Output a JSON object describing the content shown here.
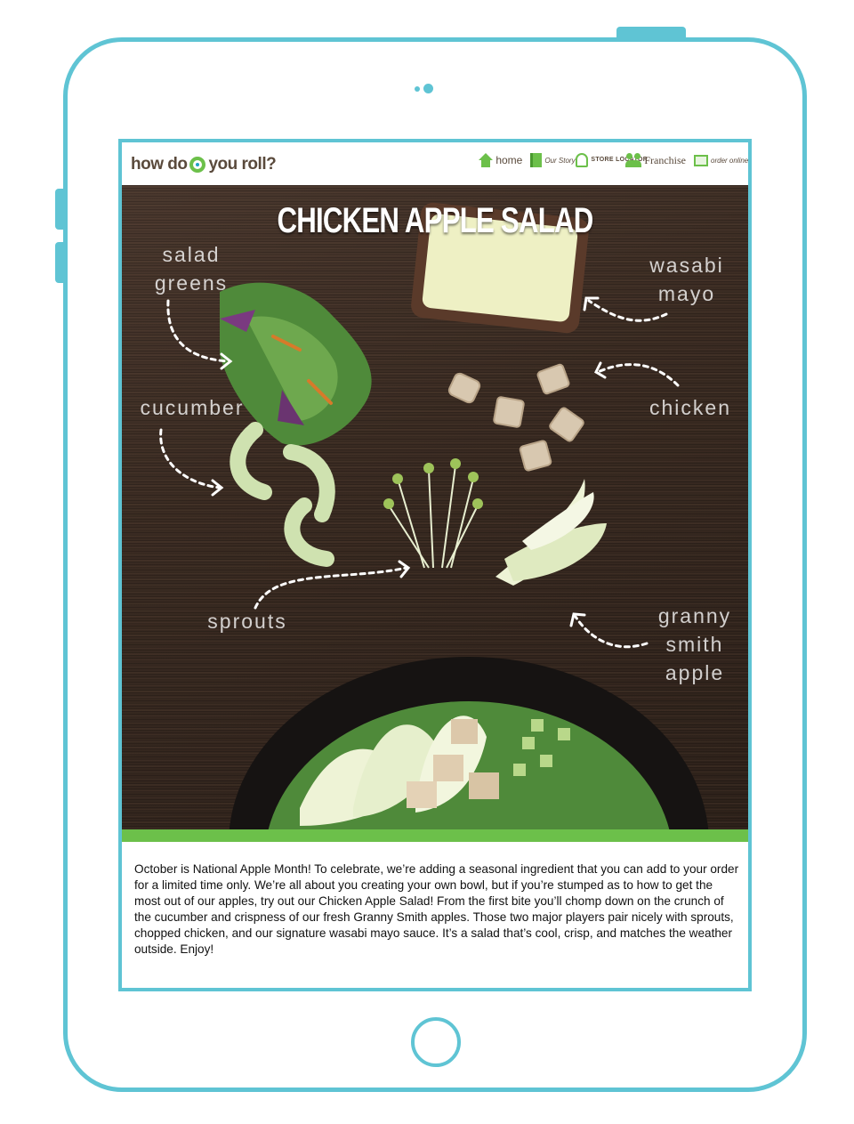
{
  "site": {
    "logo_text_1": "how do",
    "logo_text_2": "you roll?",
    "nav": [
      {
        "label": "home",
        "icon": "house-icon"
      },
      {
        "label": "Our Story",
        "icon": "book-icon"
      },
      {
        "label": "STORE LOCATOR",
        "icon": "map-pin-icon"
      },
      {
        "label": "Franchise",
        "icon": "people-icon"
      },
      {
        "label": "order online",
        "icon": "monitor-icon"
      }
    ]
  },
  "hero": {
    "title": "CHICKEN APPLE SALAD",
    "labels": {
      "salad_greens": "salad greens",
      "wasabi_mayo": "wasabi mayo",
      "cucumber": "cucumber",
      "chicken": "chicken",
      "sprouts": "sprouts",
      "granny_smith_apple": "granny smith apple"
    }
  },
  "article": {
    "body": " October is National Apple Month! To celebrate, we’re adding a seasonal ingredient that you can add to your order for a limited time only. We’re all about you creating your own bowl, but if you’re stumped as to how to get the most out of our apples, try out our Chicken Apple Salad! From the first bite you’ll chomp down on the crunch of the cucumber and crispness of our fresh Granny Smith apples. Those two major players pair nicely with sprouts, chopped chicken, and our signature wasabi mayo sauce. It’s a salad that’s cool, crisp, and matches the weather outside. Enjoy!"
  },
  "colors": {
    "frame": "#5fc4d4",
    "brand_green": "#6cc04a",
    "wood": "#3a2b22"
  }
}
